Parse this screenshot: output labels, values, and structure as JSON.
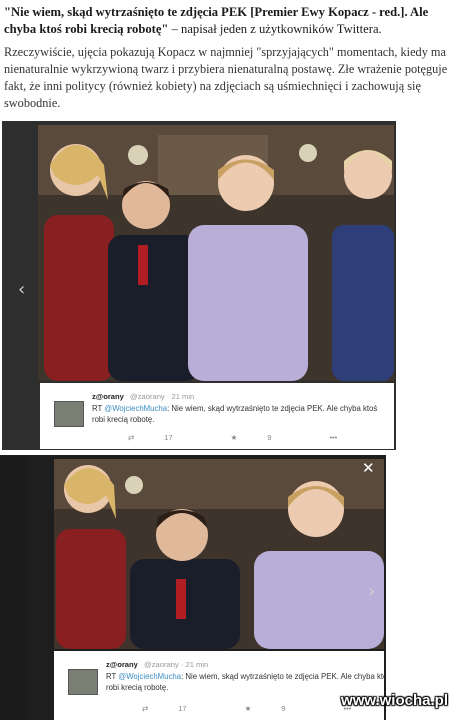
{
  "article": {
    "headline_bold": "\"Nie wiem, skąd wytrzaśnięto te zdjęcia PEK [Premier Ewy Kopacz - red.]. Ale chyba ktoś robi krecią robotę\"",
    "headline_rest": " – napisał jeden z użytkowników Twittera.",
    "paragraph": "Rzeczywiście, ujęcia pokazują Kopacz w najmniej \"sprzyjających\" momentach, kiedy ma nienaturalnie wykrzywioną twarz i przybiera nienaturalną postawę. Złe wrażenie potęguje fakt, że inni politycy (również kobiety) na zdjęciach są uśmiechnięci i zachowują się swobodnie."
  },
  "screenshot_1": {
    "prev_arrow": "‹",
    "tweet": {
      "name": "z@orany",
      "handle": "@zaorany · 21 min",
      "rt": "RT ",
      "mention": "@WojciechMucha",
      "text": ": Nie wiem, skąd wytrzaśnięto te zdjęcia PEK. Ale chyba ktoś robi krecią robotę.",
      "retweets": "17",
      "favorites": "9",
      "more": "•••"
    }
  },
  "screenshot_2": {
    "close": "✕",
    "next_arrow": "›",
    "tweet": {
      "name": "z@orany",
      "handle": "@zaorany · 21 min",
      "rt": "RT ",
      "mention": "@WojciechMucha",
      "text": ": Nie wiem, skąd wytrzaśnięto te zdjęcia PEK. Ale chyba ktoś robi krecią robotę.",
      "retweets": "17",
      "favorites": "9",
      "more": "•••"
    }
  },
  "watermark": "www.wiocha.pl",
  "colors": {
    "link": "#3b8ec2",
    "overlay_dark": "#2e2e2e"
  }
}
